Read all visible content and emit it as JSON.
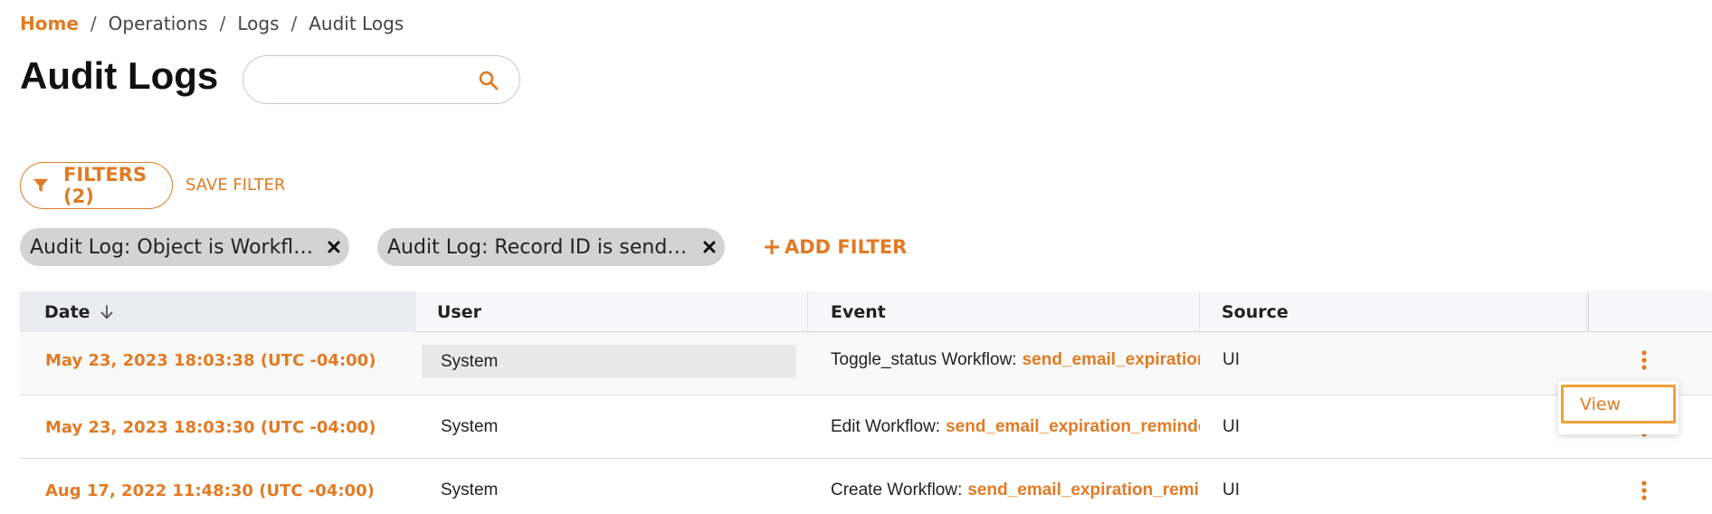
{
  "breadcrumb": {
    "items": [
      "Home",
      "Operations",
      "Logs",
      "Audit Logs"
    ],
    "separator": "/"
  },
  "page": {
    "title": "Audit Logs"
  },
  "search": {
    "placeholder": "",
    "value": "",
    "icon": "search-icon"
  },
  "filters": {
    "button_label": "FILTERS (2)",
    "save_label": "SAVE FILTER",
    "add_label": "ADD FILTER",
    "chips": [
      {
        "label": "Audit Log: Object is Workflow"
      },
      {
        "label": "Audit Log: Record ID is send_email_expiration_reminder"
      }
    ]
  },
  "table": {
    "columns": [
      "Date",
      "User",
      "Event",
      "Source"
    ],
    "sort": {
      "column": "Date",
      "direction": "descending"
    },
    "rows": [
      {
        "date": "May 23, 2023 18:03:38 (UTC -04:00)",
        "user": "System",
        "event_prefix": "Toggle_status Workflow:",
        "event_link": "send_email_expiration_reminder",
        "source": "UI"
      },
      {
        "date": "May 23, 2023 18:03:30 (UTC -04:00)",
        "user": "System",
        "event_prefix": "Edit Workflow:",
        "event_link": "send_email_expiration_reminder",
        "source": "UI"
      },
      {
        "date": "Aug 17, 2022 11:48:30 (UTC -04:00)",
        "user": "System",
        "event_prefix": "Create Workflow:",
        "event_link": "send_email_expiration_reminder",
        "source": "UI"
      }
    ]
  },
  "row_menu": {
    "items": [
      "View"
    ]
  },
  "colors": {
    "accent": "#e07b24",
    "chip_bg": "#d3d3d3",
    "header_bg": "#f7f7f9",
    "menu_focus": "#f0a038"
  }
}
